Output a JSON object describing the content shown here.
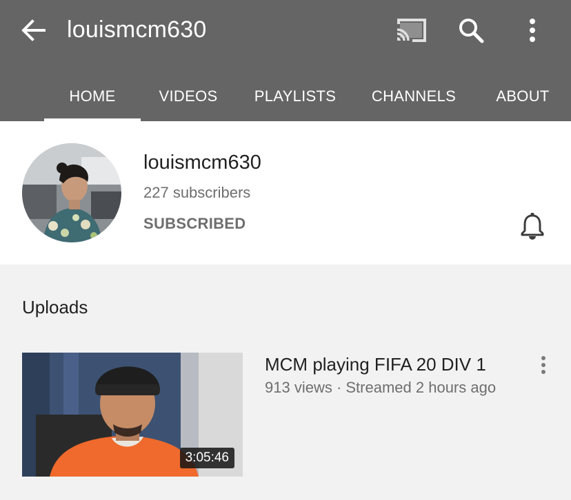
{
  "app_bar": {
    "title": "louismcm630",
    "icons": {
      "back": "arrow-back-icon",
      "cast": "cast-icon",
      "search": "search-icon",
      "more": "more-vert-icon"
    }
  },
  "tabs": [
    {
      "label": "HOME",
      "active": true
    },
    {
      "label": "VIDEOS",
      "active": false
    },
    {
      "label": "PLAYLISTS",
      "active": false
    },
    {
      "label": "CHANNELS",
      "active": false
    },
    {
      "label": "ABOUT",
      "active": false
    }
  ],
  "channel": {
    "name": "louismcm630",
    "subscribers": "227 subscribers",
    "subscribe_label": "SUBSCRIBED",
    "bell_icon": "notification-bell-icon"
  },
  "uploads": {
    "heading": "Uploads",
    "videos": [
      {
        "title": "MCM playing FIFA 20 DIV 1",
        "meta": "913 views · Streamed 2 hours ago",
        "duration": "3:05:46"
      }
    ]
  },
  "colors": {
    "app_bar": "#656565",
    "header_bg": "#ffffff",
    "page_bg": "#f2f2f2",
    "primary_text": "#212121",
    "secondary_text": "#6e6e6e"
  }
}
